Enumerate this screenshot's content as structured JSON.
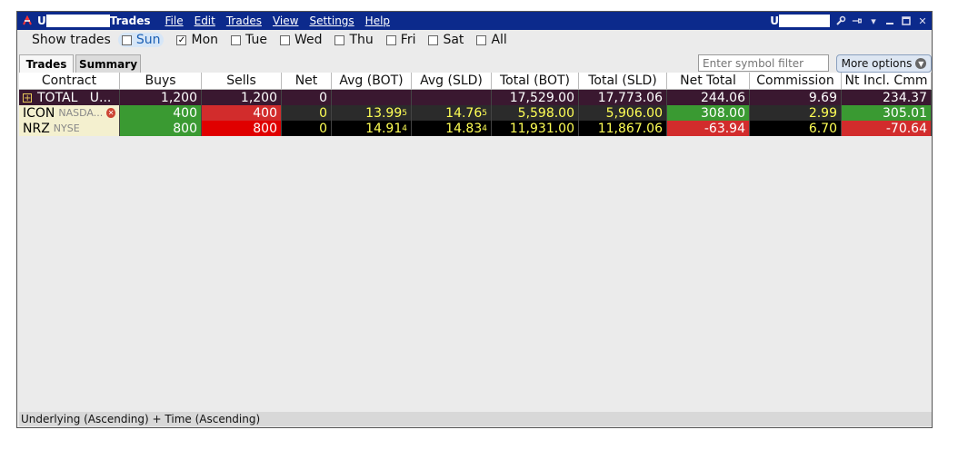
{
  "titlebar": {
    "account_prefix": "U",
    "window_title": "Trades",
    "menu": [
      "File",
      "Edit",
      "Trades",
      "View",
      "Settings",
      "Help"
    ],
    "right_account_prefix": "U"
  },
  "day_filter": {
    "label": "Show trades",
    "days": [
      {
        "label": "Sun",
        "checked": false,
        "highlighted": true
      },
      {
        "label": "Mon",
        "checked": true
      },
      {
        "label": "Tue",
        "checked": false
      },
      {
        "label": "Wed",
        "checked": false
      },
      {
        "label": "Thu",
        "checked": false
      },
      {
        "label": "Fri",
        "checked": false
      },
      {
        "label": "Sat",
        "checked": false
      },
      {
        "label": "All",
        "checked": false
      }
    ]
  },
  "tabs": {
    "trades": "Trades",
    "summary": "Summary"
  },
  "symbol_filter": {
    "placeholder": "Enter symbol filter"
  },
  "more_options": "More options",
  "columns": [
    "Contract",
    "Buys",
    "Sells",
    "Net",
    "Avg (BOT)",
    "Avg (SLD)",
    "Total (BOT)",
    "Total (SLD)",
    "Net Total",
    "Commission",
    "Nt Incl. Cmm"
  ],
  "rows": {
    "total": {
      "contract": "TOTAL",
      "contract_suffix": "U...",
      "buys": "1,200",
      "sells": "1,200",
      "net": "0",
      "avg_bot": "",
      "avg_sld": "",
      "total_bot": "17,529.00",
      "total_sld": "17,773.06",
      "net_total": "244.06",
      "commission": "9.69",
      "net_incl": "234.37"
    },
    "icon": {
      "symbol": "ICON",
      "exchange": "NASDA...",
      "buys": "400",
      "sells": "400",
      "net": "0",
      "avg_bot": "13.99",
      "avg_bot_sup": "5",
      "avg_sld": "14.76",
      "avg_sld_sup": "5",
      "total_bot": "5,598.00",
      "total_sld": "5,906.00",
      "net_total": "308.00",
      "commission": "2.99",
      "net_incl": "305.01"
    },
    "nrz": {
      "symbol": "NRZ",
      "exchange": "NYSE",
      "buys": "800",
      "sells": "800",
      "net": "0",
      "avg_bot": "14.91",
      "avg_bot_sup": "4",
      "avg_sld": "14.83",
      "avg_sld_sup": "4",
      "total_bot": "11,931.00",
      "total_sld": "11,867.06",
      "net_total": "-63.94",
      "commission": "6.70",
      "net_incl": "-70.64"
    }
  },
  "status_bar": "Underlying (Ascending)  +  Time (Ascending)",
  "colors": {
    "titlebar": "#0c2a8c",
    "positive": "#3a9a32",
    "negative": "#d22c2c",
    "highlight_text": "#ffff55"
  }
}
